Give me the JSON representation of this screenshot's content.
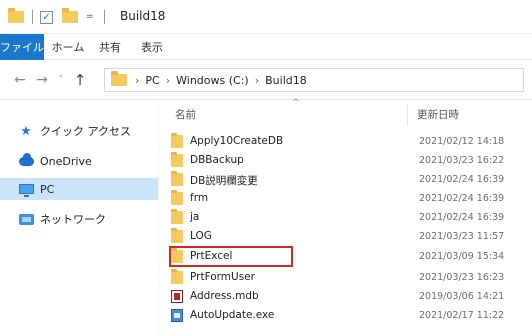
{
  "titlebar": {
    "title": "Build18",
    "quick_access_checked": "✓",
    "quick_access_dropdown": "="
  },
  "ribbon": {
    "tabs": [
      {
        "label": "ファイル"
      },
      {
        "label": "ホーム"
      },
      {
        "label": "共有"
      },
      {
        "label": "表示"
      }
    ]
  },
  "address": {
    "crumbs": [
      "PC",
      "Windows (C:)",
      "Build18"
    ],
    "separator": "›"
  },
  "sidebar": {
    "items": [
      {
        "label": "クイック アクセス",
        "icon": "star-icon"
      },
      {
        "label": "OneDrive",
        "icon": "cloud-icon"
      },
      {
        "label": "PC",
        "icon": "computer-icon",
        "selected": true
      },
      {
        "label": "ネットワーク",
        "icon": "network-icon"
      }
    ]
  },
  "columns": {
    "name": "名前",
    "date": "更新日時"
  },
  "files": [
    {
      "name": "Apply10CreateDB",
      "date": "2021/02/12 14:18",
      "type": "folder"
    },
    {
      "name": "DBBackup",
      "date": "2021/03/23 16:22",
      "type": "folder"
    },
    {
      "name": "DB説明欄変更",
      "date": "2021/02/24 16:39",
      "type": "folder"
    },
    {
      "name": "frm",
      "date": "2021/02/24 16:39",
      "type": "folder"
    },
    {
      "name": "ja",
      "date": "2021/02/24 16:39",
      "type": "folder"
    },
    {
      "name": "LOG",
      "date": "2021/03/23 11:57",
      "type": "folder"
    },
    {
      "name": "PrtExcel",
      "date": "2021/03/09 15:34",
      "type": "folder",
      "highlighted": true
    },
    {
      "name": "PrtFormUser",
      "date": "2021/03/23 16:23",
      "type": "folder"
    },
    {
      "name": "Address.mdb",
      "date": "2019/03/06 14:21",
      "type": "mdb"
    },
    {
      "name": "AutoUpdate.exe",
      "date": "2021/02/17 11:22",
      "type": "exe"
    }
  ],
  "colors": {
    "file_tab": "#1979ca",
    "selection": "#cce4f7",
    "highlight_box": "#cc2a2a",
    "folder": "#f4c95d"
  }
}
